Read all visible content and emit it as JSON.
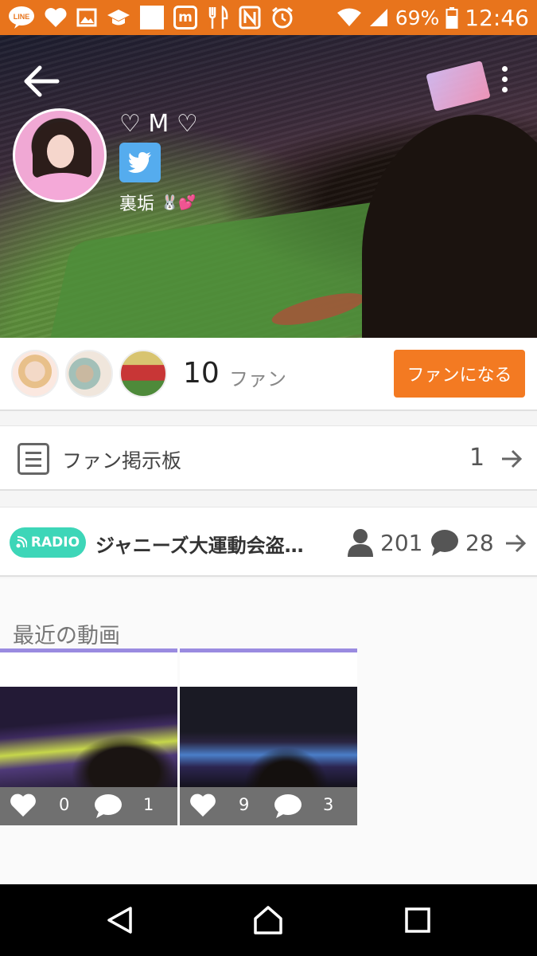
{
  "status_bar": {
    "icons": [
      "line-icon",
      "heart-icon",
      "image-icon",
      "graduation-cap-icon",
      "blank-notification-icon",
      "m-app-icon",
      "restaurant-icon",
      "nfc-icon",
      "alarm-icon",
      "wifi-icon",
      "signal-icon"
    ],
    "m_app_letter": "m",
    "battery": "69%",
    "time": "12:46",
    "background_color": "#e8741c"
  },
  "profile": {
    "name": "♡ M ♡",
    "subtitle": "裏垢",
    "subtitle_emoji": "🐰💕",
    "twitter_color": "#55acee"
  },
  "fans": {
    "count": "10",
    "label": "ファン",
    "button_label": "ファンになる",
    "button_color": "#f37a22"
  },
  "bbs": {
    "label": "ファン掲示板",
    "count": "1"
  },
  "radio": {
    "badge_label": "RADIO",
    "badge_color": "#3dd6b8",
    "title": "ジャニーズ大運動会盗…",
    "listeners": "201",
    "comments": "28"
  },
  "videos": {
    "section_title": "最近の動画",
    "items": [
      {
        "likes": "0",
        "comments": "1"
      },
      {
        "likes": "9",
        "comments": "3"
      }
    ],
    "accent_color": "#9a8be0"
  },
  "nav": {
    "buttons": [
      "back-nav",
      "home-nav",
      "recents-nav"
    ]
  }
}
